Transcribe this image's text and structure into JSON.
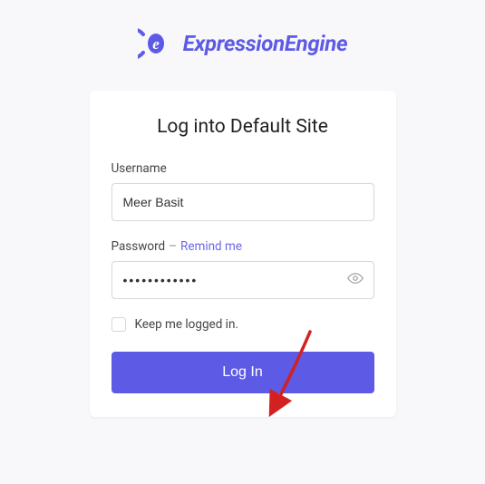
{
  "brand": {
    "name": "ExpressionEngine"
  },
  "card": {
    "title": "Log into Default Site"
  },
  "username": {
    "label": "Username",
    "value": "Meer Basit"
  },
  "password": {
    "label": "Password",
    "separator": "–",
    "remind_link": "Remind me",
    "value": "••••••••••••"
  },
  "remember": {
    "label": "Keep me logged in."
  },
  "login_button": "Log In"
}
